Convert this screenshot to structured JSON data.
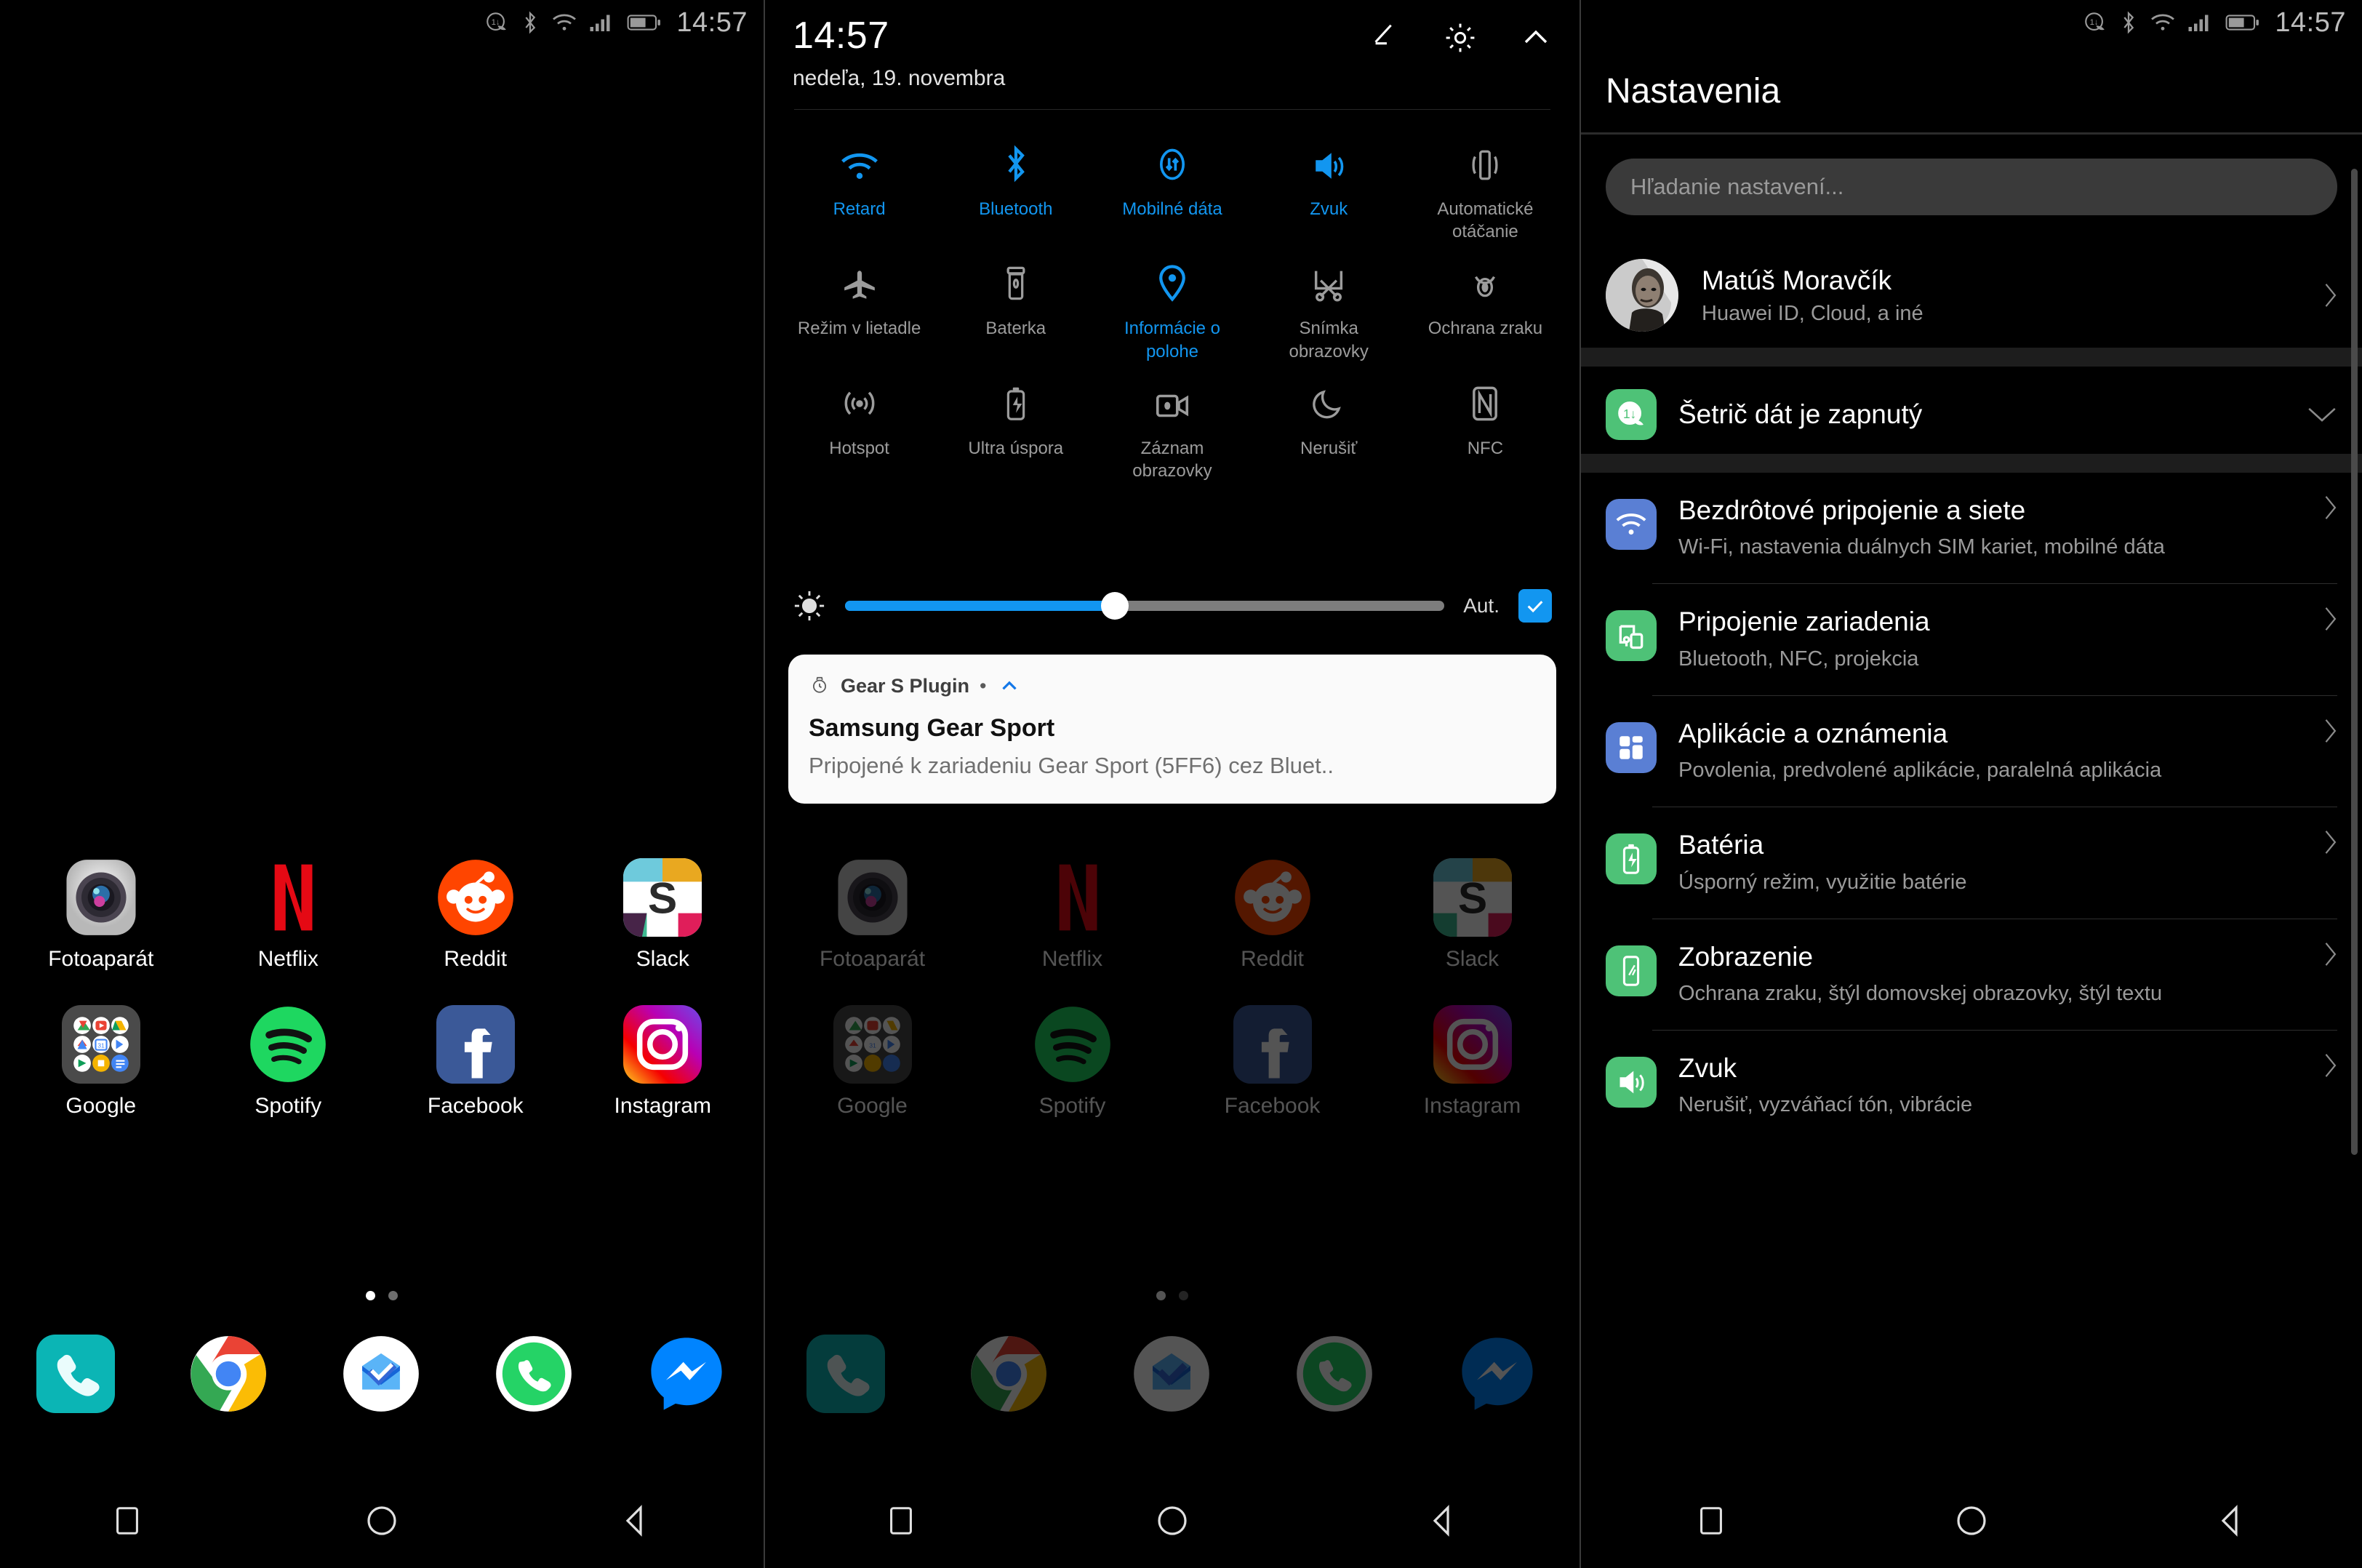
{
  "status_bar": {
    "time": "14:57",
    "icons": [
      "data-saver-icon",
      "bluetooth-icon",
      "wifi-icon",
      "signal-icon",
      "battery-icon"
    ]
  },
  "home": {
    "apps": [
      {
        "label": "Fotoaparát",
        "icon": "camera-icon"
      },
      {
        "label": "Netflix",
        "icon": "netflix-icon"
      },
      {
        "label": "Reddit",
        "icon": "reddit-icon"
      },
      {
        "label": "Slack",
        "icon": "slack-icon"
      },
      {
        "label": "Google",
        "icon": "google-folder-icon"
      },
      {
        "label": "Spotify",
        "icon": "spotify-icon"
      },
      {
        "label": "Facebook",
        "icon": "facebook-icon"
      },
      {
        "label": "Instagram",
        "icon": "instagram-icon"
      }
    ],
    "dock": [
      {
        "label": "Telefón",
        "icon": "phone-icon"
      },
      {
        "label": "Chrome",
        "icon": "chrome-icon"
      },
      {
        "label": "Email",
        "icon": "email-icon"
      },
      {
        "label": "WhatsApp",
        "icon": "whatsapp-icon"
      },
      {
        "label": "Messenger",
        "icon": "messenger-icon"
      }
    ],
    "page_dots": {
      "count": 2,
      "active_index": 0
    },
    "navbar": [
      "recents-icon",
      "home-icon",
      "back-icon"
    ]
  },
  "shade": {
    "time": "14:57",
    "date": "nedeľa, 19. novembra",
    "actions": [
      "edit-icon",
      "gear-icon",
      "collapse-chevron-up-icon"
    ],
    "quick_settings": [
      {
        "label": "Retard",
        "icon": "wifi-icon",
        "on": true
      },
      {
        "label": "Bluetooth",
        "icon": "bluetooth-icon",
        "on": true
      },
      {
        "label": "Mobilné dáta",
        "icon": "mobile-data-icon",
        "on": true
      },
      {
        "label": "Zvuk",
        "icon": "sound-icon",
        "on": true
      },
      {
        "label": "Automatické otáčanie",
        "icon": "auto-rotate-icon",
        "on": false
      },
      {
        "label": "Režim v lietadle",
        "icon": "airplane-icon",
        "on": false
      },
      {
        "label": "Baterka",
        "icon": "flashlight-icon",
        "on": false
      },
      {
        "label": "Informácie o polohe",
        "icon": "location-pin-icon",
        "on": true
      },
      {
        "label": "Snímka obrazovky",
        "icon": "screenshot-icon",
        "on": false
      },
      {
        "label": "Ochrana zraku",
        "icon": "eye-comfort-icon",
        "on": false
      },
      {
        "label": "Hotspot",
        "icon": "hotspot-icon",
        "on": false
      },
      {
        "label": "Ultra úspora",
        "icon": "ultra-power-saving-icon",
        "on": false
      },
      {
        "label": "Záznam obrazovky",
        "icon": "screen-record-icon",
        "on": false
      },
      {
        "label": "Nerušiť",
        "icon": "do-not-disturb-moon-icon",
        "on": false
      },
      {
        "label": "NFC",
        "icon": "nfc-icon",
        "on": false
      }
    ],
    "brightness": {
      "icon": "brightness-icon",
      "value_percent": 45,
      "auto_label": "Aut.",
      "auto_checked": true
    },
    "notification": {
      "app_icon": "watch-icon",
      "app_name": "Gear S Plugin",
      "separator": "•",
      "expand_icon": "chevron-up-icon",
      "title": "Samsung Gear Sport",
      "body": "Pripojené k zariadeniu Gear Sport (5FF6) cez Bluet.."
    }
  },
  "settings": {
    "title": "Nastavenia",
    "search_placeholder": "Hľadanie nastavení...",
    "account": {
      "name": "Matúš Moravčík",
      "subtitle": "Huawei ID, Cloud, a iné",
      "chevron": "chevron-right-icon",
      "avatar": "user-avatar"
    },
    "data_saver": {
      "icon": "data-saver-icon",
      "label": "Šetrič dát je zapnutý",
      "chevron": "chevron-down-icon"
    },
    "items": [
      {
        "title": "Bezdrôtové pripojenie a siete",
        "subtitle": "Wi-Fi, nastavenia duálnych SIM kariet, mobilné dáta",
        "icon": "wifi-icon",
        "color": "#5a7fd4",
        "chevron": "chevron-right-icon"
      },
      {
        "title": "Pripojenie zariadenia",
        "subtitle": "Bluetooth, NFC, projekcia",
        "icon": "device-connect-icon",
        "color": "#4ec277",
        "chevron": "chevron-right-icon"
      },
      {
        "title": "Aplikácie a oznámenia",
        "subtitle": "Povolenia, predvolené aplikácie, paralelná aplikácia",
        "icon": "apps-grid-icon",
        "color": "#5a7fd4",
        "chevron": "chevron-right-icon"
      },
      {
        "title": "Batéria",
        "subtitle": "Úsporný režim, využitie batérie",
        "icon": "battery-icon",
        "color": "#4ec277",
        "chevron": "chevron-right-icon"
      },
      {
        "title": "Zobrazenie",
        "subtitle": "Ochrana zraku, štýl domovskej obrazovky, štýl textu",
        "icon": "display-icon",
        "color": "#4ec277",
        "chevron": "chevron-right-icon"
      },
      {
        "title": "Zvuk",
        "subtitle": "Nerušiť, vyzváňací tón, vibrácie",
        "icon": "sound-icon",
        "color": "#4ec277",
        "chevron": "chevron-right-icon"
      }
    ]
  },
  "colors": {
    "accent_blue": "#1296f0",
    "accent_green": "#4ec277",
    "background": "#000000",
    "muted_text": "#9a9a9a"
  }
}
